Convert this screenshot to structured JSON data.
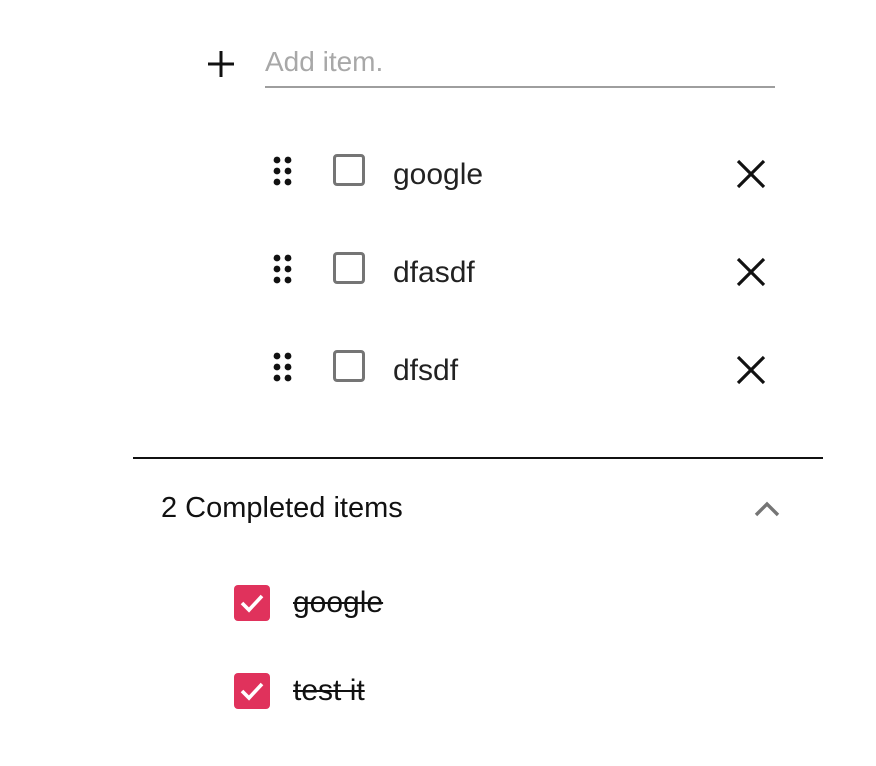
{
  "add_item": {
    "placeholder": "Add item.",
    "value": "",
    "icon": "plus-icon"
  },
  "active_items": [
    {
      "label": "google",
      "checked": false
    },
    {
      "label": "dfasdf",
      "checked": false
    },
    {
      "label": "dfsdf",
      "checked": false
    }
  ],
  "completed": {
    "header": "2 Completed items",
    "expanded": true,
    "items": [
      {
        "label": "google",
        "checked": true
      },
      {
        "label": "test it",
        "checked": true
      }
    ]
  },
  "colors": {
    "accent": "#e0325c",
    "unchecked_border": "#757575",
    "input_underline": "#9e9e9e",
    "placeholder": "#a8a8a8"
  }
}
